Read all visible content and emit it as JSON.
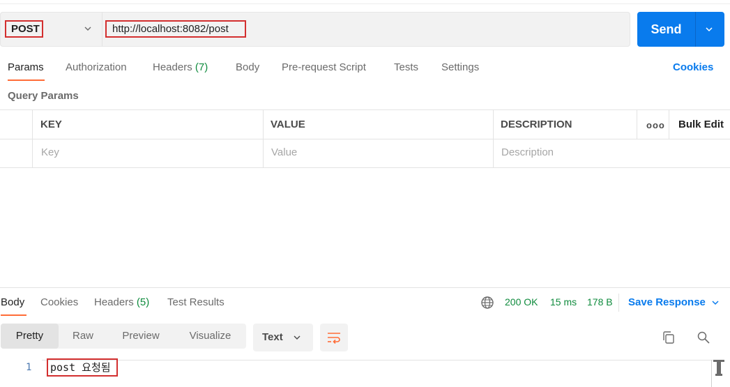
{
  "request": {
    "method": "POST",
    "url": "http://localhost:8082/post",
    "send_label": "Send"
  },
  "request_tabs": [
    {
      "label": "Params",
      "active": true
    },
    {
      "label": "Authorization"
    },
    {
      "label": "Headers",
      "count": "(7)"
    },
    {
      "label": "Body"
    },
    {
      "label": "Pre-request Script"
    },
    {
      "label": "Tests"
    },
    {
      "label": "Settings"
    }
  ],
  "cookies_link": "Cookies",
  "query_params": {
    "title": "Query Params",
    "columns": [
      "KEY",
      "VALUE",
      "DESCRIPTION"
    ],
    "more_label": "ooo",
    "bulk_edit": "Bulk Edit",
    "placeholders": [
      "Key",
      "Value",
      "Description"
    ]
  },
  "response": {
    "tabs": [
      {
        "label": "Body",
        "active": true
      },
      {
        "label": "Cookies"
      },
      {
        "label": "Headers",
        "count": "(5)"
      },
      {
        "label": "Test Results"
      }
    ],
    "status": "200 OK",
    "time": "15 ms",
    "size": "178 B",
    "save_label": "Save Response",
    "view_modes": [
      "Pretty",
      "Raw",
      "Preview",
      "Visualize"
    ],
    "active_view": "Pretty",
    "format": "Text",
    "lines": [
      {
        "num": "1",
        "text": "post 요청됨"
      }
    ]
  },
  "colors": {
    "accent": "#097bed",
    "active_tab": "#ff6c37",
    "success": "#0f8b3d",
    "highlight_border": "#d32f2f"
  },
  "icons": [
    "chevron-down-icon",
    "globe-icon",
    "wrap-lines-icon",
    "copy-icon",
    "search-icon",
    "text-cursor-icon"
  ]
}
